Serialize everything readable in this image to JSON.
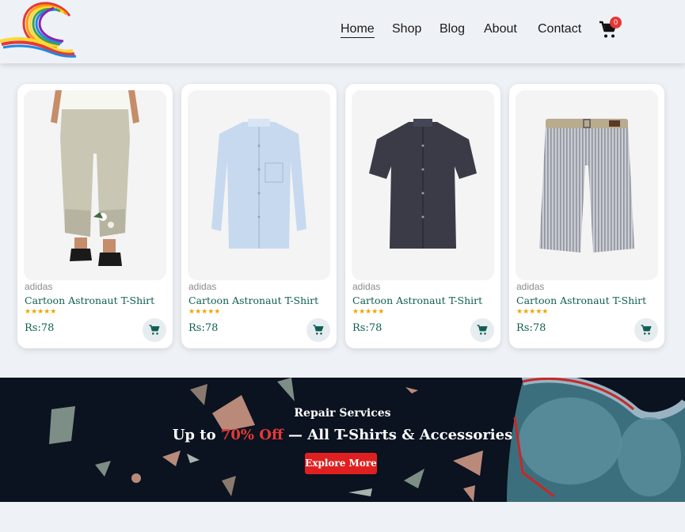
{
  "nav": {
    "items": [
      "Home",
      "Shop",
      "Blog",
      "About",
      "Contact"
    ],
    "cart_count": "0"
  },
  "products": [
    {
      "brand": "adidas",
      "title": "Cartoon Astronaut T-Shirt",
      "stars": "★★★★★",
      "price": "Rs:78",
      "image": "linen-pants-floral"
    },
    {
      "brand": "adidas",
      "title": "Cartoon Astronaut T-Shirt",
      "stars": "★★★★★",
      "price": "Rs:78",
      "image": "light-blue-long-sleeve-shirt"
    },
    {
      "brand": "adidas",
      "title": "Cartoon Astronaut T-Shirt",
      "stars": "★★★★★",
      "price": "Rs:78",
      "image": "dark-short-sleeve-shirt"
    },
    {
      "brand": "adidas",
      "title": "Cartoon Astronaut T-Shirt",
      "stars": "★★★★★",
      "price": "Rs:78",
      "image": "striped-shorts-with-belt"
    }
  ],
  "banner": {
    "subtitle": "Repair Services",
    "headline_pre": "Up to ",
    "headline_highlight": "70% Off",
    "headline_post": " — All T-Shirts & Accessories",
    "cta_label": "Explore More"
  },
  "colors": {
    "accent": "#0e5e52",
    "badge": "#e53935",
    "star": "#f0a500",
    "banner_bg": "#0b1220",
    "cta": "#e02020"
  }
}
